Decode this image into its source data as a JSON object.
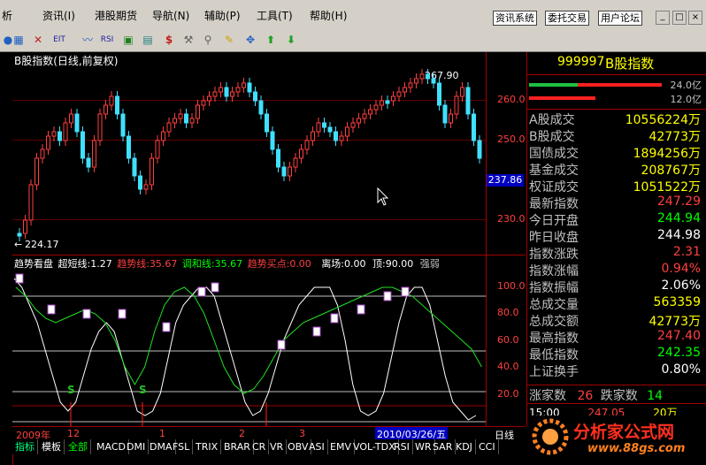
{
  "menu": {
    "items": [
      "析",
      "资讯(I)",
      "港股期货",
      "导航(N)",
      "辅助(P)",
      "工具(T)",
      "帮助(H)"
    ]
  },
  "top_buttons": [
    "资讯系统",
    "委托交易",
    "用户论坛"
  ],
  "chart": {
    "title": "B股指数(日线,前复权)",
    "price_ticks": [
      "260.0",
      "250.0",
      "230.0"
    ],
    "high_label": "267.90",
    "low_label": "224.17",
    "current_price": "237.86",
    "indicator_ticks": [
      "100.0",
      "80.0",
      "60.0",
      "40.0",
      "20.0"
    ],
    "ind_name": "趋势看盘",
    "ind_super": "超短线:1.27",
    "ind_trend": "趋势线:35.67",
    "ind_adjust": "调和线:35.67",
    "ind_buy": "趋势买点:0.00",
    "ind_leave": "离场:0.00",
    "ind_top": "顶:90.00",
    "ind_weak": "强弱",
    "s_marks": [
      "S",
      "S"
    ]
  },
  "timeline": {
    "labels": [
      "2009年",
      "12",
      "1",
      "2",
      "3"
    ],
    "date": "2010/03/26/五",
    "period": "日线"
  },
  "tabs": [
    "指标",
    "模板",
    "全部",
    "MACD",
    "DMI",
    "DMA",
    "FSL",
    "TRIX",
    "BRAR",
    "CR",
    "VR",
    "OBV",
    "ASI",
    "EMV",
    "VOL-TDX",
    "RSI",
    "WR",
    "SAR",
    "KDJ",
    "CCI"
  ],
  "panel": {
    "code": "999997",
    "name": "B股指数",
    "bar1": "24.0亿",
    "bar2": "12.0亿",
    "rows": [
      {
        "label": "A股成交",
        "value": "10556224万",
        "color": "#ffff00"
      },
      {
        "label": "B股成交",
        "value": "42773万",
        "color": "#ffff00"
      },
      {
        "label": "国债成交",
        "value": "1894256万",
        "color": "#ffff00"
      },
      {
        "label": "基金成交",
        "value": "208767万",
        "color": "#ffff00"
      },
      {
        "label": "权证成交",
        "value": "1051522万",
        "color": "#ffff00"
      },
      {
        "label": "最新指数",
        "value": "247.29",
        "color": "#ff4040"
      },
      {
        "label": "今日开盘",
        "value": "244.94",
        "color": "#00ff00"
      },
      {
        "label": "昨日收盘",
        "value": "244.98",
        "color": "#ffffff"
      },
      {
        "label": "指数涨跌",
        "value": "2.31",
        "color": "#ff4040"
      },
      {
        "label": "指数涨幅",
        "value": "0.94%",
        "color": "#ff4040"
      },
      {
        "label": "指数振幅",
        "value": "2.06%",
        "color": "#ffffff"
      },
      {
        "label": "总成交量",
        "value": "563359",
        "color": "#ffff00"
      },
      {
        "label": "总成交额",
        "value": "42773万",
        "color": "#ffff00"
      },
      {
        "label": "最高指数",
        "value": "247.40",
        "color": "#ff4040"
      },
      {
        "label": "最低指数",
        "value": "242.35",
        "color": "#00ff00"
      },
      {
        "label": "上证换手",
        "value": "0.80%",
        "color": "#ffffff"
      }
    ],
    "up_label": "涨家数",
    "up_value": "26",
    "down_label": "跌家数",
    "down_value": "14",
    "time": "15:00",
    "time_price": "247.05",
    "time_vol": "20万"
  },
  "watermark": {
    "text": "分析家公式网",
    "url": "www.88gs.com"
  }
}
